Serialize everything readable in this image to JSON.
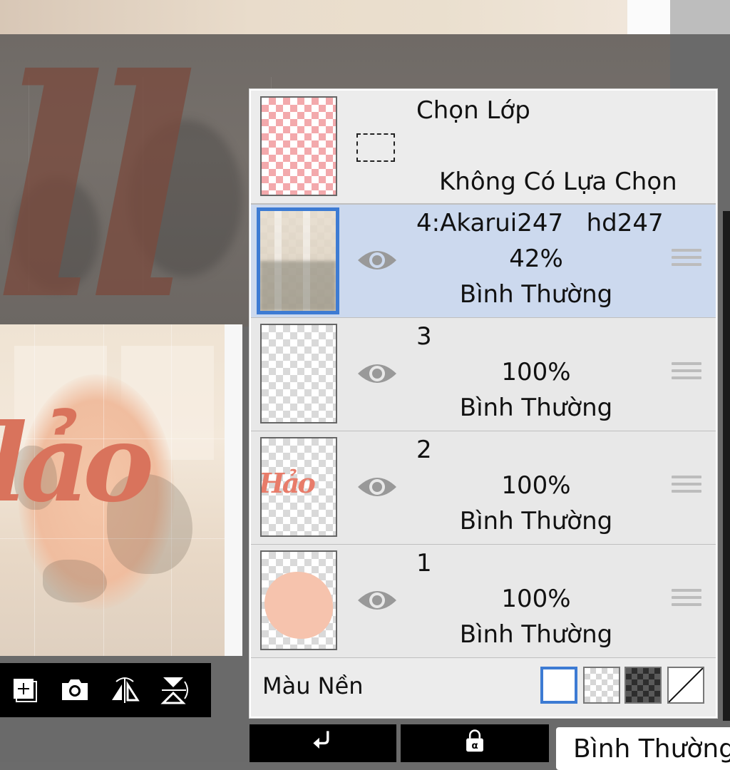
{
  "selection": {
    "title": "Chọn Lớp",
    "subtitle": "Không Có Lựa Chọn"
  },
  "layers": [
    {
      "name": "4:Akarui247   hd247",
      "opacity": "42%",
      "blend": "Bình Thường",
      "active": true
    },
    {
      "name": "3",
      "opacity": "100%",
      "blend": "Bình Thường",
      "active": false
    },
    {
      "name": "2",
      "opacity": "100%",
      "blend": "Bình Thường",
      "active": false
    },
    {
      "name": "1",
      "opacity": "100%",
      "blend": "Bình Thường",
      "active": false
    }
  ],
  "background": {
    "label": "Màu Nền",
    "options": [
      "white",
      "transparent-light",
      "transparent-dark",
      "none"
    ],
    "selected": "white"
  },
  "bottom": {
    "blend_mode_value": "Bình Thường"
  },
  "icons": {
    "canvas_toolbar": [
      "add-layer-icon",
      "camera-icon",
      "flip-horizontal-icon",
      "flip-vertical-icon"
    ],
    "layer_visibility": "eye-icon",
    "layer_handle": "drag-handle-icon",
    "clipping": "clipping-arrow-icon",
    "alpha_lock": "alpha-lock-icon"
  },
  "colors": {
    "active_layer_bg": "#ccd9ee",
    "accent_blue": "#3d7bd3",
    "panel_bg": "#efefef"
  }
}
